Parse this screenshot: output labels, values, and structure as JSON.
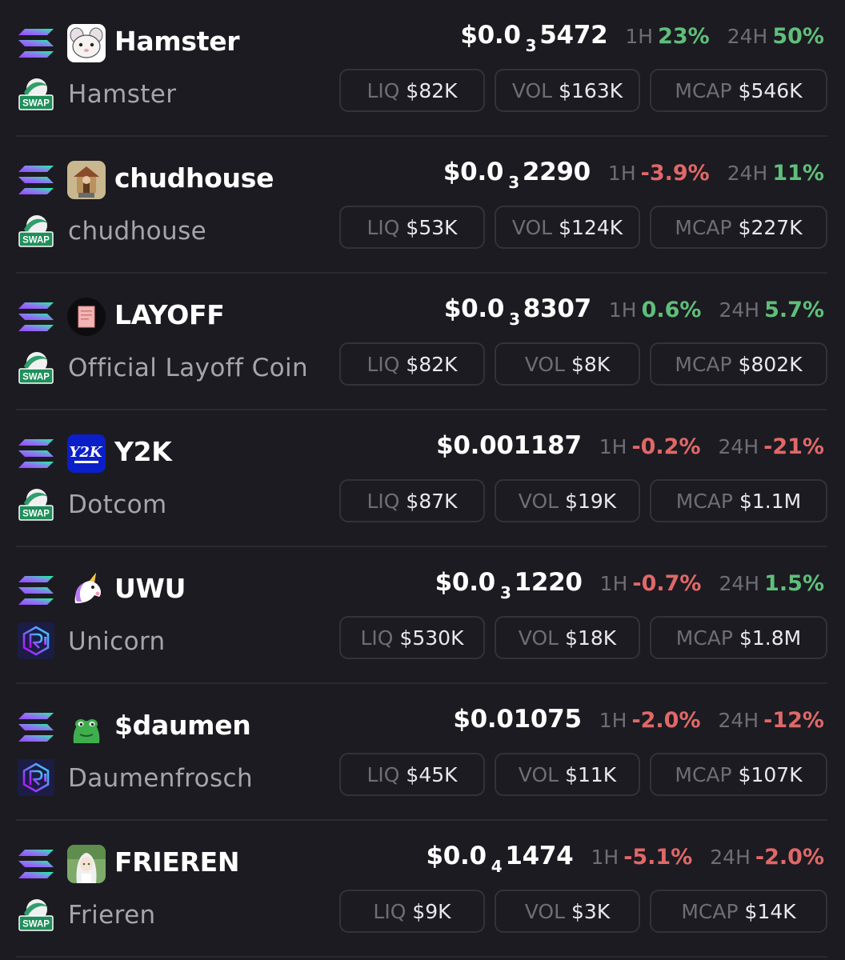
{
  "labels": {
    "h1": "1H",
    "h24": "24H",
    "liq": "LIQ",
    "vol": "VOL",
    "mcap": "MCAP",
    "swap": "SWAP"
  },
  "colors": {
    "background": "#1c1b21",
    "positive": "#5fbf7a",
    "negative": "#e06868",
    "muted": "#6e6d75",
    "border": "#33323a"
  },
  "tokens": [
    {
      "symbol": "Hamster",
      "name": "Hamster",
      "avatar": "hamster-avatar",
      "dex": "swap",
      "price_prefix": "$0.0",
      "price_zeros": "3",
      "price_digits": "5472",
      "h1": "23%",
      "h1_dir": "up",
      "h24": "50%",
      "h24_dir": "up",
      "liq": "$82K",
      "vol": "$163K",
      "mcap": "$546K"
    },
    {
      "symbol": "chudhouse",
      "name": "chudhouse",
      "avatar": "chudhouse-avatar",
      "dex": "swap",
      "price_prefix": "$0.0",
      "price_zeros": "3",
      "price_digits": "2290",
      "h1": "-3.9%",
      "h1_dir": "down",
      "h24": "11%",
      "h24_dir": "up",
      "liq": "$53K",
      "vol": "$124K",
      "mcap": "$227K"
    },
    {
      "symbol": "LAYOFF",
      "name": "Official Layoff Coin",
      "avatar": "layoff-avatar",
      "dex": "swap",
      "price_prefix": "$0.0",
      "price_zeros": "3",
      "price_digits": "8307",
      "h1": "0.6%",
      "h1_dir": "up",
      "h24": "5.7%",
      "h24_dir": "up",
      "liq": "$82K",
      "vol": "$8K",
      "mcap": "$802K"
    },
    {
      "symbol": "Y2K",
      "name": "Dotcom",
      "avatar": "y2k-avatar",
      "dex": "swap",
      "price_prefix": "$0.001187",
      "price_zeros": "",
      "price_digits": "",
      "h1": "-0.2%",
      "h1_dir": "down",
      "h24": "-21%",
      "h24_dir": "down",
      "liq": "$87K",
      "vol": "$19K",
      "mcap": "$1.1M"
    },
    {
      "symbol": "UWU",
      "name": "Unicorn",
      "avatar": "unicorn-avatar",
      "dex": "raydium",
      "price_prefix": "$0.0",
      "price_zeros": "3",
      "price_digits": "1220",
      "h1": "-0.7%",
      "h1_dir": "down",
      "h24": "1.5%",
      "h24_dir": "up",
      "liq": "$530K",
      "vol": "$18K",
      "mcap": "$1.8M"
    },
    {
      "symbol": "$daumen",
      "name": "Daumenfrosch",
      "avatar": "frog-avatar",
      "dex": "raydium",
      "price_prefix": "$0.01075",
      "price_zeros": "",
      "price_digits": "",
      "h1": "-2.0%",
      "h1_dir": "down",
      "h24": "-12%",
      "h24_dir": "down",
      "liq": "$45K",
      "vol": "$11K",
      "mcap": "$107K"
    },
    {
      "symbol": "FRIEREN",
      "name": "Frieren",
      "avatar": "frieren-avatar",
      "dex": "swap",
      "price_prefix": "$0.0",
      "price_zeros": "4",
      "price_digits": "1474",
      "h1": "-5.1%",
      "h1_dir": "down",
      "h24": "-2.0%",
      "h24_dir": "down",
      "liq": "$9K",
      "vol": "$3K",
      "mcap": "$14K"
    }
  ]
}
